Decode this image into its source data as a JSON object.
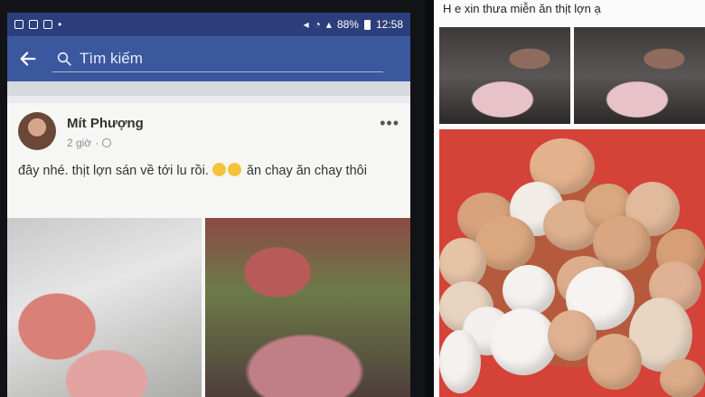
{
  "phone_screen": {
    "status_bar": {
      "battery": "88%",
      "time": "12:58"
    },
    "search": {
      "placeholder": "Tìm kiếm"
    },
    "post": {
      "author": "Mít Phượng",
      "time": "2 giờ",
      "text_part1": "đây nhé. thịt lợn sán về tới lu rồi.",
      "text_part2": "ăn chay ăn chay thôi",
      "more_label": "•••"
    }
  },
  "right_post": {
    "caption": "H e xin thưa miễn ăn thịt lợn ạ"
  },
  "colors": {
    "facebook_blue": "#3b579d",
    "status_bar": "#2c3f7c"
  }
}
